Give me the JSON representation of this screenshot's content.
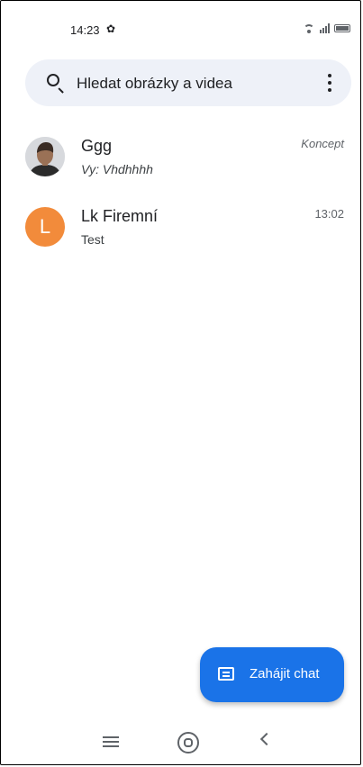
{
  "status_bar": {
    "time": "14:23"
  },
  "search": {
    "placeholder": "Hledat obrázky a videa"
  },
  "conversations": [
    {
      "name": "Ggg",
      "snippet": "Vy: Vhdhhhh",
      "meta": "Koncept",
      "avatar_letter": ""
    },
    {
      "name": "Lk Firemní",
      "snippet": "Test",
      "meta": "13:02",
      "avatar_letter": "L"
    }
  ],
  "fab": {
    "label": "Zahájit chat"
  },
  "colors": {
    "accent": "#1a73e8",
    "avatar_orange": "#f28b3b",
    "search_bg": "#eef1f8"
  },
  "icons": [
    "settings-icon",
    "wifi-icon",
    "signal-icon",
    "battery-icon",
    "search-icon",
    "more-icon",
    "chat-icon",
    "menu-icon",
    "home-icon",
    "back-icon"
  ]
}
